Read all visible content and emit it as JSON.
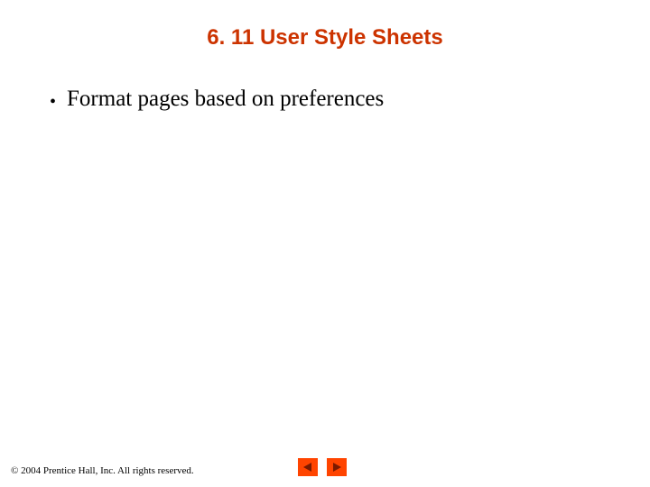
{
  "title": "6. 11  User Style Sheets",
  "bullets": {
    "first": "Format pages based on preferences"
  },
  "footer": {
    "copyright": "© 2004 Prentice Hall, Inc. All rights reserved."
  },
  "nav": {
    "prev_color": "#ff4400",
    "next_color": "#ff4400"
  }
}
